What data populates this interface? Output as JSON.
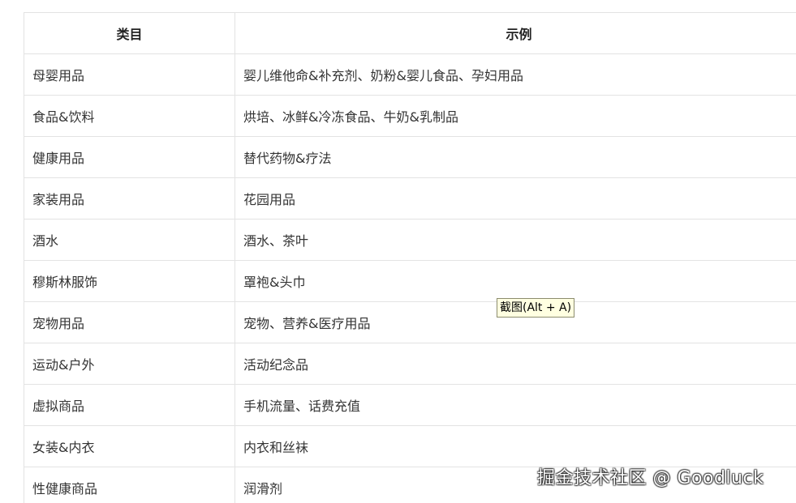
{
  "table": {
    "headers": [
      "类目",
      "示例"
    ],
    "rows": [
      [
        "母婴用品",
        "婴儿维他命&补充剂、奶粉&婴儿食品、孕妇用品"
      ],
      [
        "食品&饮料",
        "烘培、冰鲜&冷冻食品、牛奶&乳制品"
      ],
      [
        "健康用品",
        "替代药物&疗法"
      ],
      [
        "家装用品",
        "花园用品"
      ],
      [
        "酒水",
        "酒水、茶叶"
      ],
      [
        "穆斯林服饰",
        "罩袍&头巾"
      ],
      [
        "宠物用品",
        "宠物、营养&医疗用品"
      ],
      [
        "运动&户外",
        "活动纪念品"
      ],
      [
        "虚拟商品",
        "手机流量、话费充值"
      ],
      [
        "女装&内衣",
        "内衣和丝袜"
      ],
      [
        "性健康商品",
        "润滑剂"
      ]
    ]
  },
  "tooltip": {
    "text": "截图(Alt + A)"
  },
  "watermark": {
    "text": "掘金技术社区 @ Goodluck"
  }
}
